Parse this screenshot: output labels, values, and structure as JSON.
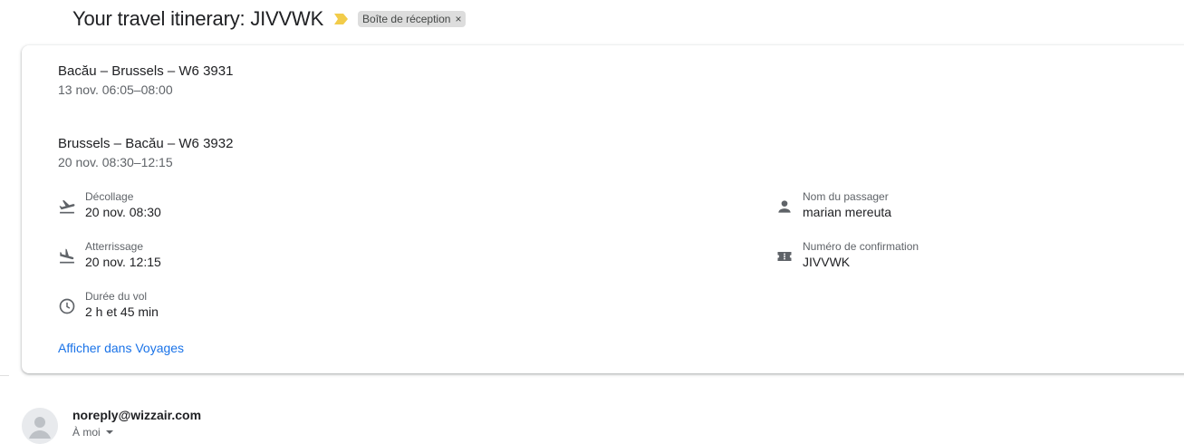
{
  "header": {
    "subject": "Your travel itinerary: JIVVWK",
    "label": "Boîte de réception",
    "label_close": "×",
    "importance_icon": "importance-marker-icon",
    "importance_color": "#f2cc4a"
  },
  "card": {
    "flights": [
      {
        "title": "Bacău – Brussels – W6 3931",
        "subtitle": "13 nov. 06:05–08:00"
      },
      {
        "title": "Brussels – Bacău – W6 3932",
        "subtitle": "20 nov. 08:30–12:15"
      }
    ],
    "details_left": [
      {
        "icon": "flight-takeoff-icon",
        "label": "Décollage",
        "value": "20 nov. 08:30"
      },
      {
        "icon": "flight-landing-icon",
        "label": "Atterrissage",
        "value": "20 nov. 12:15"
      },
      {
        "icon": "clock-icon",
        "label": "Durée du vol",
        "value": "2 h et 45 min"
      }
    ],
    "details_right": [
      {
        "icon": "person-icon",
        "label": "Nom du passager",
        "value": "marian mereuta"
      },
      {
        "icon": "ticket-icon",
        "label": "Numéro de confirmation",
        "value": "JIVVWK"
      }
    ],
    "link": "Afficher dans Voyages",
    "link_color": "#1a73e8"
  },
  "message": {
    "sender_email": "noreply@wizzair.com",
    "recipient": "À moi",
    "avatar_icon": "default-avatar-icon"
  }
}
